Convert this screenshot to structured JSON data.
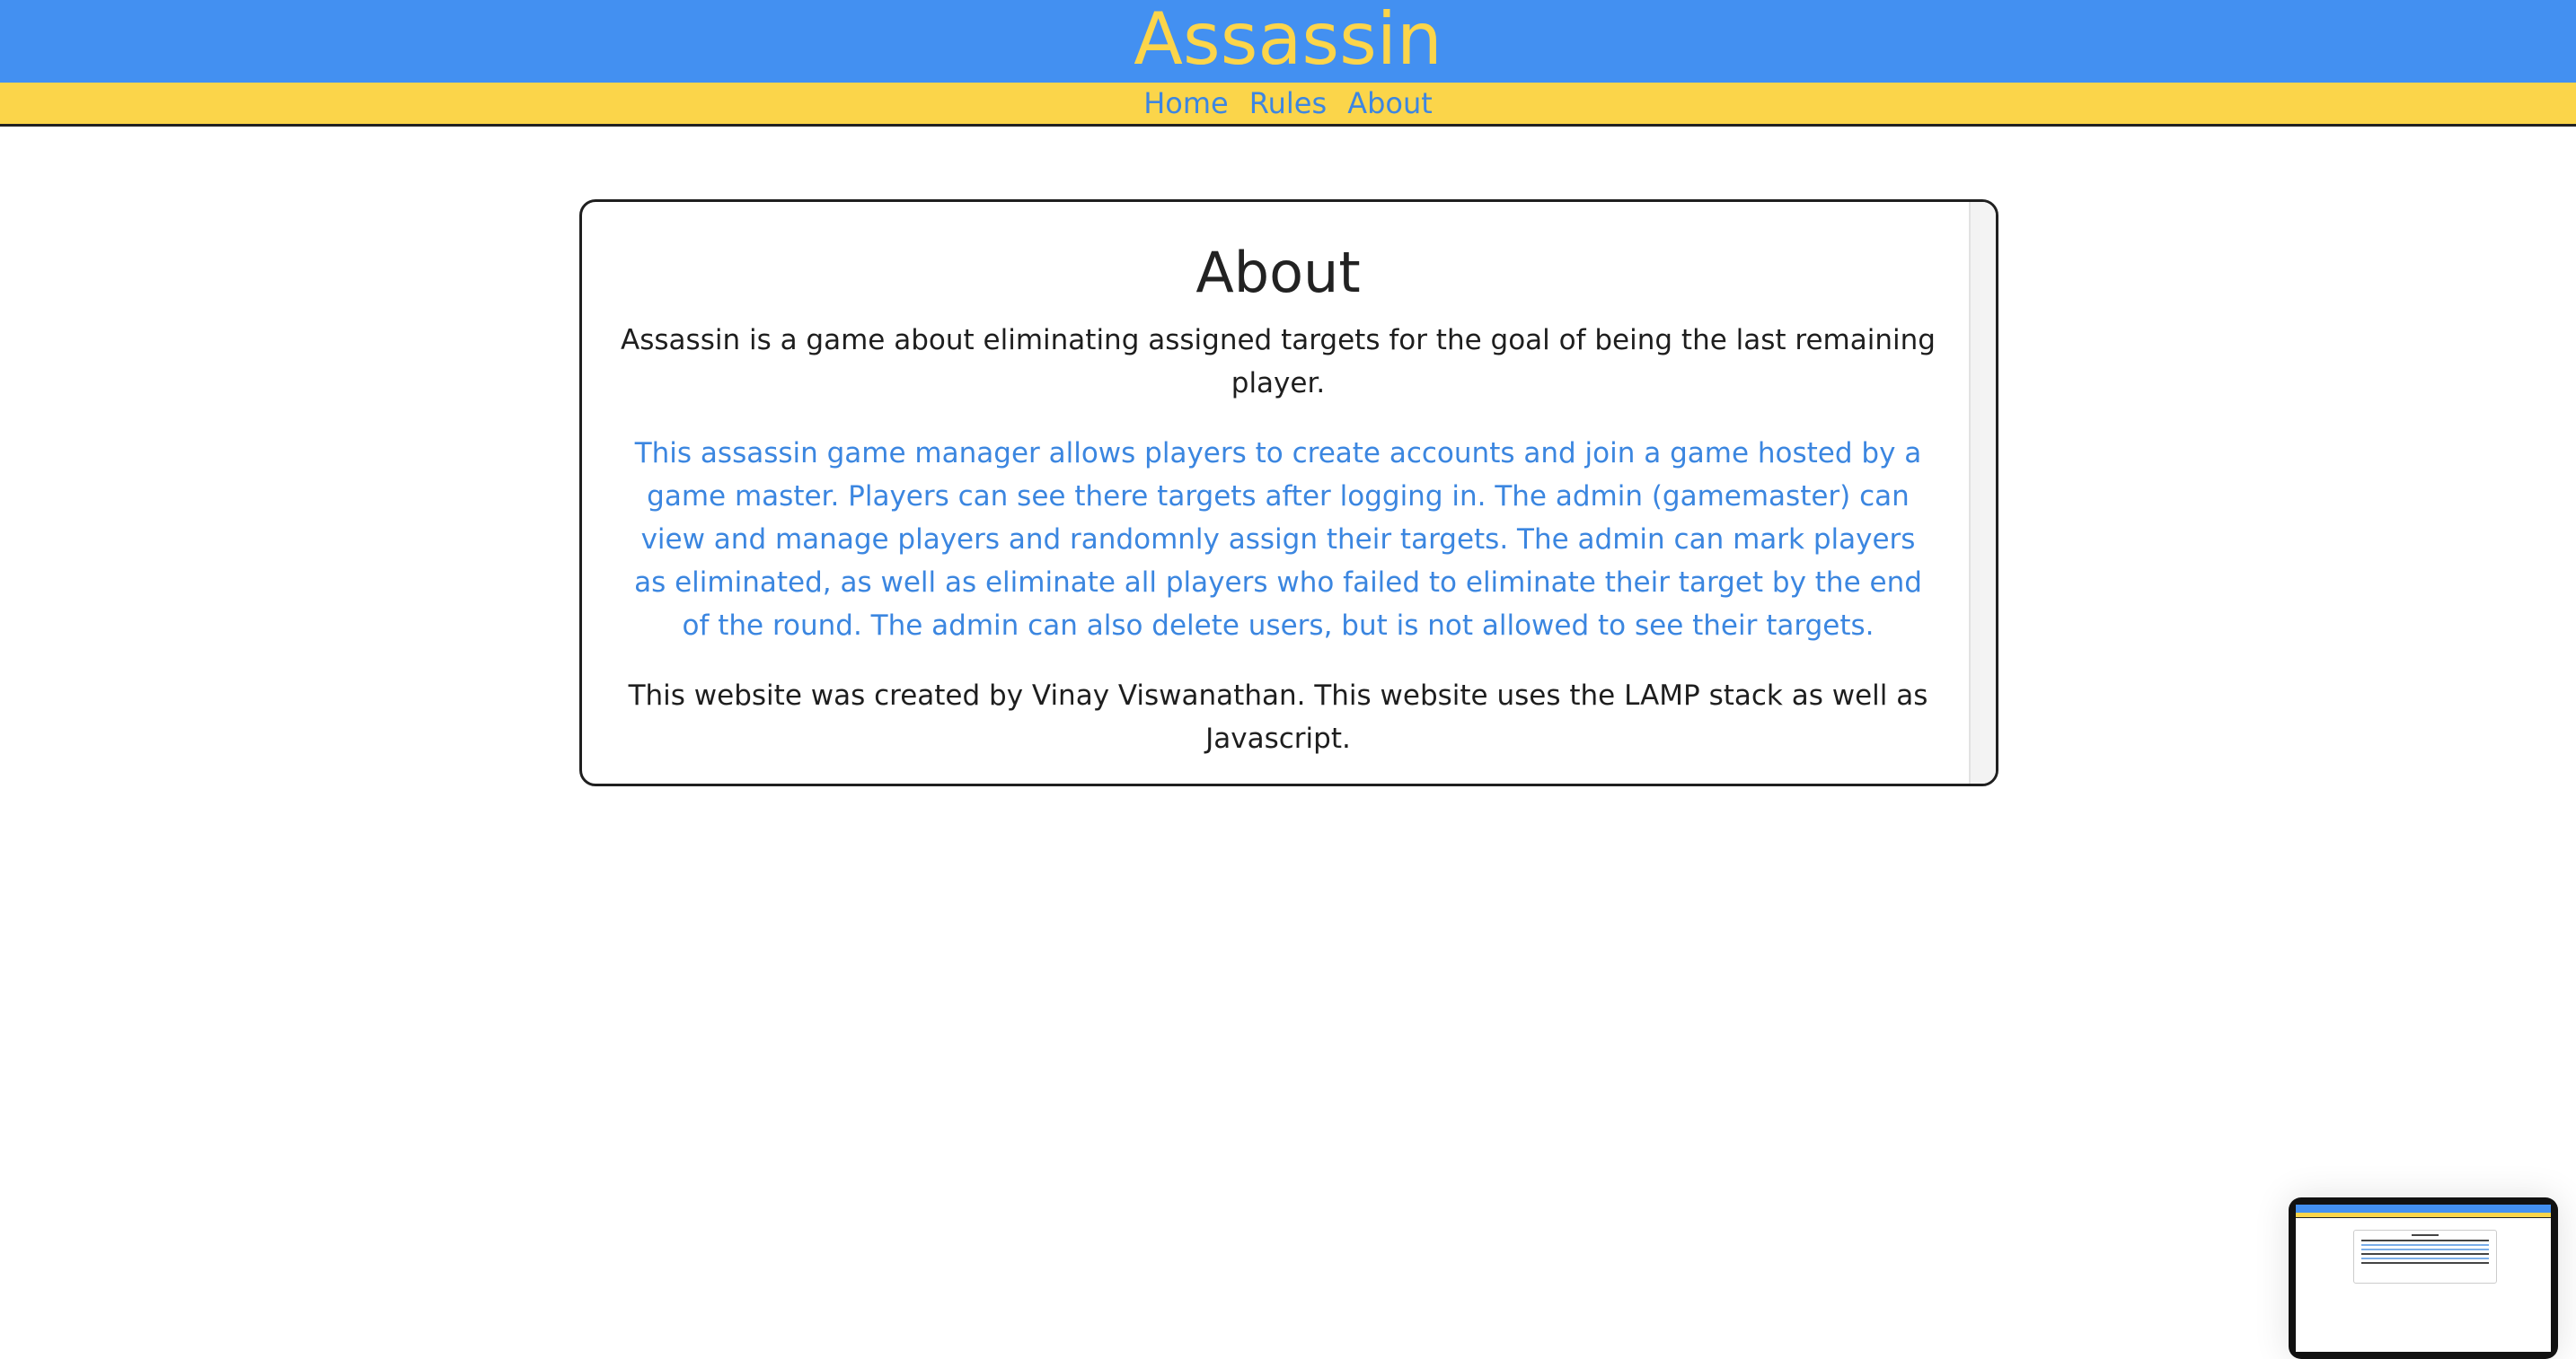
{
  "header": {
    "title": "Assassin"
  },
  "nav": {
    "items": [
      "Home",
      "Rules",
      "About"
    ]
  },
  "about": {
    "title": "About",
    "intro": "Assassin is a game about eliminating assigned targets for the goal of being the last remaining player.",
    "description": "This assassin game manager allows players to create accounts and join a game hosted by a game master. Players can see there targets after logging in. The admin (gamemaster) can view and manage players and randomnly assign their targets. The admin can mark players as eliminated, as well as eliminate all players who failed to eliminate their target by the end of the round. The admin can also delete users, but is not allowed to see their targets.",
    "credit": "This website was created by Vinay Viswanathan. This website uses the LAMP stack as well as Javascript."
  },
  "colors": {
    "header_bg": "#4390f1",
    "brand_text": "#fcd54a",
    "nav_bg": "#fbd54a",
    "link": "#3d86e2"
  }
}
